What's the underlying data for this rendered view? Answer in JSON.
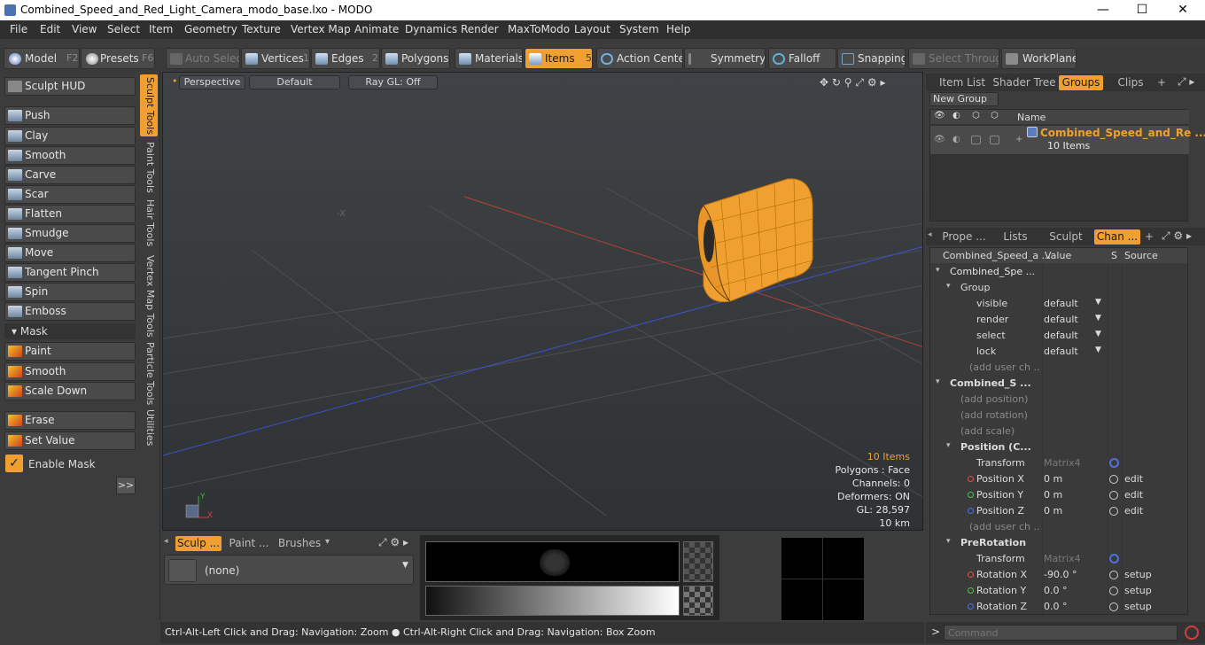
{
  "window": {
    "title": "Combined_Speed_and_Red_Light_Camera_modo_base.lxo - MODO",
    "minimize": "—",
    "maximize": "☐",
    "close": "✕"
  },
  "menu": [
    "File",
    "Edit",
    "View",
    "Select",
    "Item",
    "Geometry",
    "Texture",
    "Vertex Map",
    "Animate",
    "Dynamics",
    "Render",
    "MaxToModo",
    "Layout",
    "System",
    "Help"
  ],
  "toolbar": {
    "model": "Model",
    "model_key": "F2",
    "presets": "Presets",
    "presets_key": "F6",
    "auto_select": "Auto Select",
    "vertices": "Vertices",
    "vertices_key": "1",
    "edges": "Edges",
    "edges_key": "2",
    "polygons": "Polygons",
    "materials": "Materials",
    "items": "Items",
    "items_key": "5",
    "action_center": "Action Center",
    "symmetry": "Symmetry",
    "falloff": "Falloff",
    "snapping": "Snapping",
    "select_through": "Select Through",
    "workplane": "WorkPlane"
  },
  "left": {
    "sculpt_hud": "Sculpt HUD",
    "tools": [
      "Push",
      "Clay",
      "Smooth",
      "Carve",
      "Scar",
      "Flatten",
      "Smudge",
      "Move",
      "Tangent Pinch",
      "Spin",
      "Emboss"
    ],
    "mask_header": "Mask",
    "mask_tools": [
      "Paint",
      "Smooth",
      "Scale Down"
    ],
    "erase": "Erase",
    "set_value": "Set Value",
    "enable_mask": "Enable Mask",
    "more": ">>",
    "vtabs": [
      "Sculpt Tools",
      "Paint Tools",
      "Hair Tools",
      "Vertex Map Tools",
      "Particle Tools",
      "Utilities"
    ]
  },
  "viewport": {
    "perspective": "Perspective",
    "default": "Default",
    "raygl": "Ray GL: Off",
    "info": {
      "items": "10 Items",
      "polygons": "Polygons : Face",
      "channels": "Channels: 0",
      "deformers": "Deformers: ON",
      "gl": "GL: 28,597",
      "scale": "10 km"
    },
    "axis_y": "Y",
    "axis_x": "X"
  },
  "bottom": {
    "tabs": [
      "Sculp ...",
      "Paint ...",
      "Brushes"
    ],
    "preset": "(none)"
  },
  "status": {
    "hint": "Ctrl-Alt-Left Click and Drag: Navigation: Zoom ● Ctrl-Alt-Right Click and Drag: Navigation: Box Zoom",
    "command_placeholder": "Command",
    "prompt": ">"
  },
  "right_top": {
    "tabs": [
      "Item List",
      "Shader Tree",
      "Groups",
      "Clips",
      "+"
    ],
    "new_group": "New Group",
    "name_header": "Name",
    "group_name": "Combined_Speed_and_Re ...",
    "group_count": "10 Items"
  },
  "right_bottom": {
    "tabs": [
      "Prope ...",
      "Lists",
      "Sculpt",
      "Chan ...",
      "+"
    ],
    "headers": {
      "name": "Combined_Speed_a ...",
      "value": "Value",
      "s": "S",
      "source": "Source"
    },
    "rows": [
      {
        "name": "Combined_Spe ...",
        "value": "",
        "source": ""
      },
      {
        "name": "Group",
        "value": "",
        "source": ""
      },
      {
        "name": "visible",
        "value": "default",
        "source": ""
      },
      {
        "name": "render",
        "value": "default",
        "source": ""
      },
      {
        "name": "select",
        "value": "default",
        "source": ""
      },
      {
        "name": "lock",
        "value": "default",
        "source": ""
      },
      {
        "name": "(add user ch ...",
        "value": "",
        "source": ""
      },
      {
        "name": "Combined_S ...",
        "value": "",
        "source": ""
      },
      {
        "name": "(add position)",
        "value": "",
        "source": ""
      },
      {
        "name": "(add rotation)",
        "value": "",
        "source": ""
      },
      {
        "name": "(add scale)",
        "value": "",
        "source": ""
      },
      {
        "name": "Position (C...",
        "value": "",
        "source": ""
      },
      {
        "name": "Transform",
        "value": "Matrix4",
        "source": ""
      },
      {
        "name": "Position X",
        "value": "0 m",
        "source": "edit"
      },
      {
        "name": "Position Y",
        "value": "0 m",
        "source": "edit"
      },
      {
        "name": "Position Z",
        "value": "0 m",
        "source": "edit"
      },
      {
        "name": "(add user ch ...",
        "value": "",
        "source": ""
      },
      {
        "name": "PreRotation",
        "value": "",
        "source": ""
      },
      {
        "name": "Transform",
        "value": "Matrix4",
        "source": ""
      },
      {
        "name": "Rotation X",
        "value": "-90.0 °",
        "source": "setup"
      },
      {
        "name": "Rotation Y",
        "value": "0.0 °",
        "source": "setup"
      },
      {
        "name": "Rotation Z",
        "value": "0.0 °",
        "source": "setup"
      }
    ]
  },
  "colors": {
    "accent": "#f0a030",
    "object": "#f0a030",
    "x_axis": "#b84030",
    "z_axis": "#4050c8"
  }
}
